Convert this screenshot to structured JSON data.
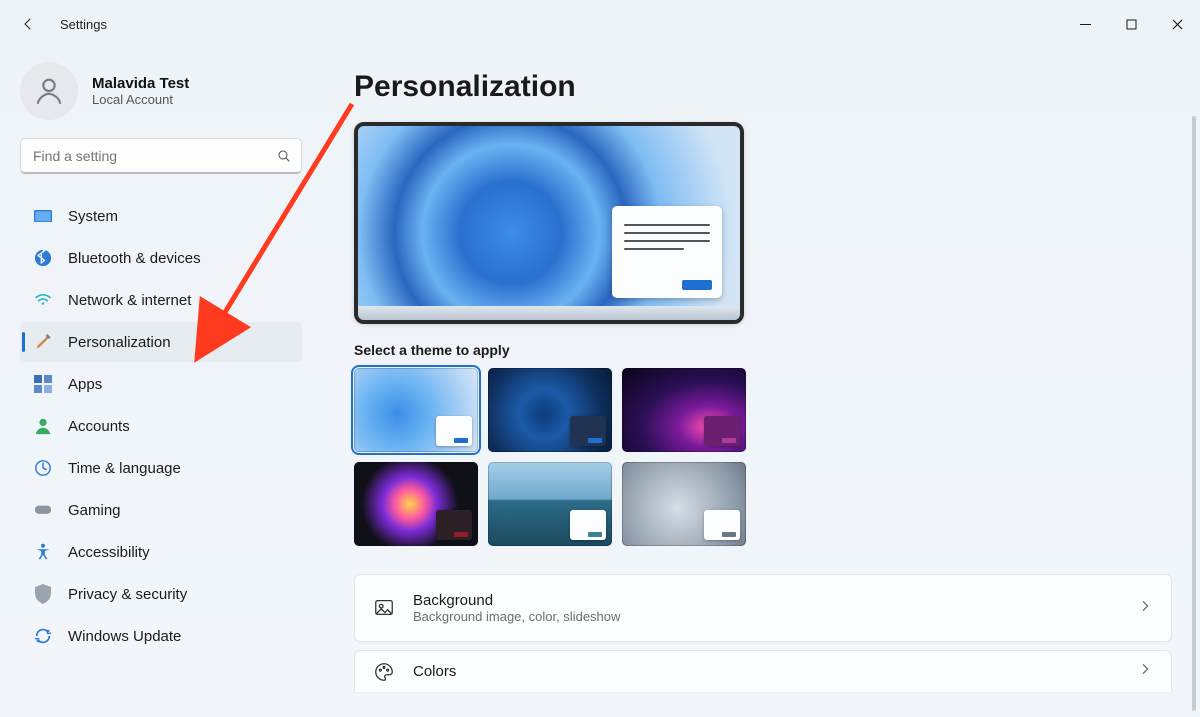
{
  "window": {
    "title": "Settings"
  },
  "profile": {
    "name": "Malavida Test",
    "sub": "Local Account"
  },
  "search": {
    "placeholder": "Find a setting"
  },
  "nav": {
    "items": [
      {
        "label": "System"
      },
      {
        "label": "Bluetooth & devices"
      },
      {
        "label": "Network & internet"
      },
      {
        "label": "Personalization"
      },
      {
        "label": "Apps"
      },
      {
        "label": "Accounts"
      },
      {
        "label": "Time & language"
      },
      {
        "label": "Gaming"
      },
      {
        "label": "Accessibility"
      },
      {
        "label": "Privacy & security"
      },
      {
        "label": "Windows Update"
      }
    ],
    "active_index": 3
  },
  "page": {
    "title": "Personalization",
    "theme_heading": "Select a theme to apply",
    "selected_theme_index": 0
  },
  "cards": {
    "background": {
      "title": "Background",
      "sub": "Background image, color, slideshow"
    },
    "colors": {
      "title": "Colors"
    }
  },
  "colors": {
    "accent": "#1f6fd0",
    "annotation": "#ff3b1f"
  }
}
